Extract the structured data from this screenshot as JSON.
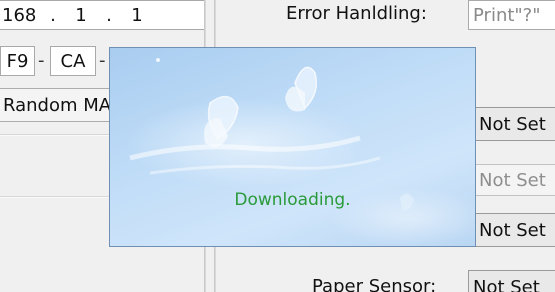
{
  "ip": {
    "octet3": "168",
    "octet4a": "1",
    "octet4b": "1",
    "dot": "."
  },
  "mac": {
    "seg1": "F9",
    "seg2": "CA",
    "dash": "-"
  },
  "random_mac_button": "Random MAC",
  "error_handling": {
    "label": "Error Hanldling:",
    "value": "Print\"?\""
  },
  "combos": {
    "combo1": "Not Set",
    "combo2": "Not Set",
    "combo3": "Not Set",
    "paper_sensor_label": "Paper Sensor:",
    "paper_sensor_value": "Not Set"
  },
  "popup": {
    "message": "Downloading."
  },
  "colors": {
    "popup_text": "#2a9a3a",
    "popup_bg": "#bfdcf7"
  }
}
